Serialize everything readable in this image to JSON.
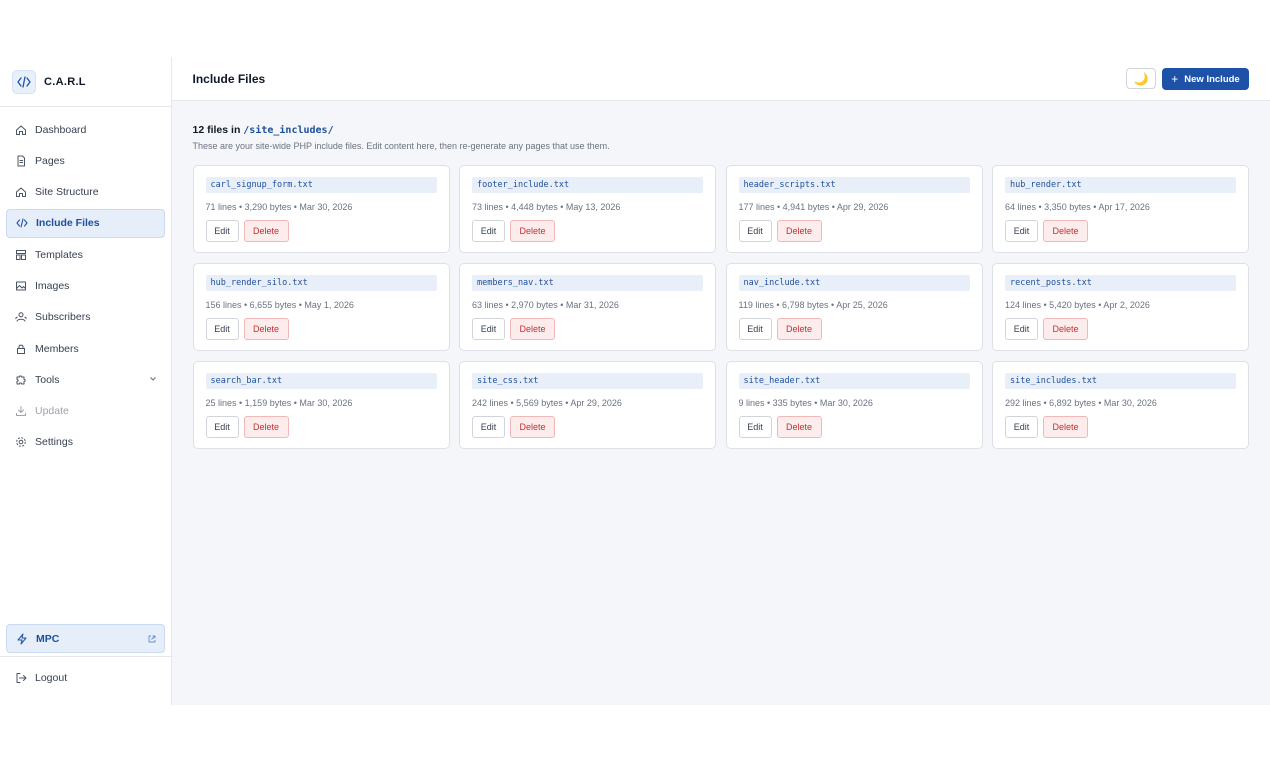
{
  "brand": {
    "name": "C.A.R.L",
    "logo_icon": "code-icon"
  },
  "sidebar": {
    "items": [
      {
        "label": "Dashboard",
        "icon": "home-icon"
      },
      {
        "label": "Pages",
        "icon": "file-icon"
      },
      {
        "label": "Site Structure",
        "icon": "home-icon"
      },
      {
        "label": "Include Files",
        "icon": "code-icon",
        "active": true
      },
      {
        "label": "Templates",
        "icon": "layout-icon"
      },
      {
        "label": "Images",
        "icon": "image-icon"
      },
      {
        "label": "Subscribers",
        "icon": "users-icon"
      },
      {
        "label": "Members",
        "icon": "lock-icon"
      },
      {
        "label": "Tools",
        "icon": "puzzle-icon",
        "expandable": true
      },
      {
        "label": "Update",
        "icon": "download-icon",
        "disabled": true
      },
      {
        "label": "Settings",
        "icon": "gear-icon"
      }
    ],
    "mpc": {
      "label": "MPC",
      "icon": "bolt-icon"
    },
    "logout": {
      "label": "Logout",
      "icon": "logout-icon"
    }
  },
  "header": {
    "title": "Include Files",
    "theme_icon": "🌙",
    "new_button_label": "New Include"
  },
  "main": {
    "summary_prefix": "12 files in",
    "summary_path": "/site_includes/",
    "description": "These are your site-wide PHP include files. Edit content here, then re-generate any pages that use them.",
    "edit_label": "Edit",
    "delete_label": "Delete",
    "files": [
      {
        "name": "carl_signup_form.txt",
        "meta": "71 lines • 3,290 bytes • Mar 30, 2026"
      },
      {
        "name": "footer_include.txt",
        "meta": "73 lines • 4,448 bytes • May 13, 2026"
      },
      {
        "name": "header_scripts.txt",
        "meta": "177 lines • 4,941 bytes • Apr 29, 2026"
      },
      {
        "name": "hub_render.txt",
        "meta": "64 lines • 3,350 bytes • Apr 17, 2026"
      },
      {
        "name": "hub_render_silo.txt",
        "meta": "156 lines • 6,655 bytes • May 1, 2026"
      },
      {
        "name": "members_nav.txt",
        "meta": "63 lines • 2,970 bytes • Mar 31, 2026"
      },
      {
        "name": "nav_include.txt",
        "meta": "119 lines • 6,798 bytes • Apr 25, 2026"
      },
      {
        "name": "recent_posts.txt",
        "meta": "124 lines • 5,420 bytes • Apr 2, 2026"
      },
      {
        "name": "search_bar.txt",
        "meta": "25 lines • 1,159 bytes • Mar 30, 2026"
      },
      {
        "name": "site_css.txt",
        "meta": "242 lines • 5,569 bytes • Apr 29, 2026"
      },
      {
        "name": "site_header.txt",
        "meta": "9 lines • 335 bytes • Mar 30, 2026"
      },
      {
        "name": "site_includes.txt",
        "meta": "292 lines • 6,892 bytes • Mar 30, 2026"
      }
    ]
  },
  "colors": {
    "accent": "#1e52a8",
    "danger": "#c53030",
    "background": "#f4f6f9"
  }
}
